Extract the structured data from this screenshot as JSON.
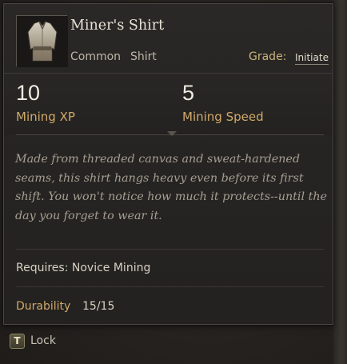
{
  "item": {
    "name": "Miner's Shirt",
    "rarity": "Common",
    "type": "Shirt",
    "grade_label": "Grade:",
    "grade_value": "Initiate",
    "icon": "shirt-icon"
  },
  "stats": [
    {
      "value": "10",
      "label": "Mining XP"
    },
    {
      "value": "5",
      "label": "Mining Speed"
    }
  ],
  "description": "Made from threaded canvas and sweat-hardened seams, this shirt hangs heavy even before its first shift. You won't notice how much it protects--until the day you forget to wear it.",
  "requires": "Requires: Novice Mining",
  "durability": {
    "label": "Durability",
    "value": "15/15"
  },
  "keybind": {
    "key": "T",
    "action": "Lock"
  },
  "colors": {
    "accent_gold": "#d1a96a",
    "grade_gold": "#c9b27c",
    "text_light": "#e8e2d6",
    "description": "#a59e92",
    "panel_bg": "#262422"
  }
}
